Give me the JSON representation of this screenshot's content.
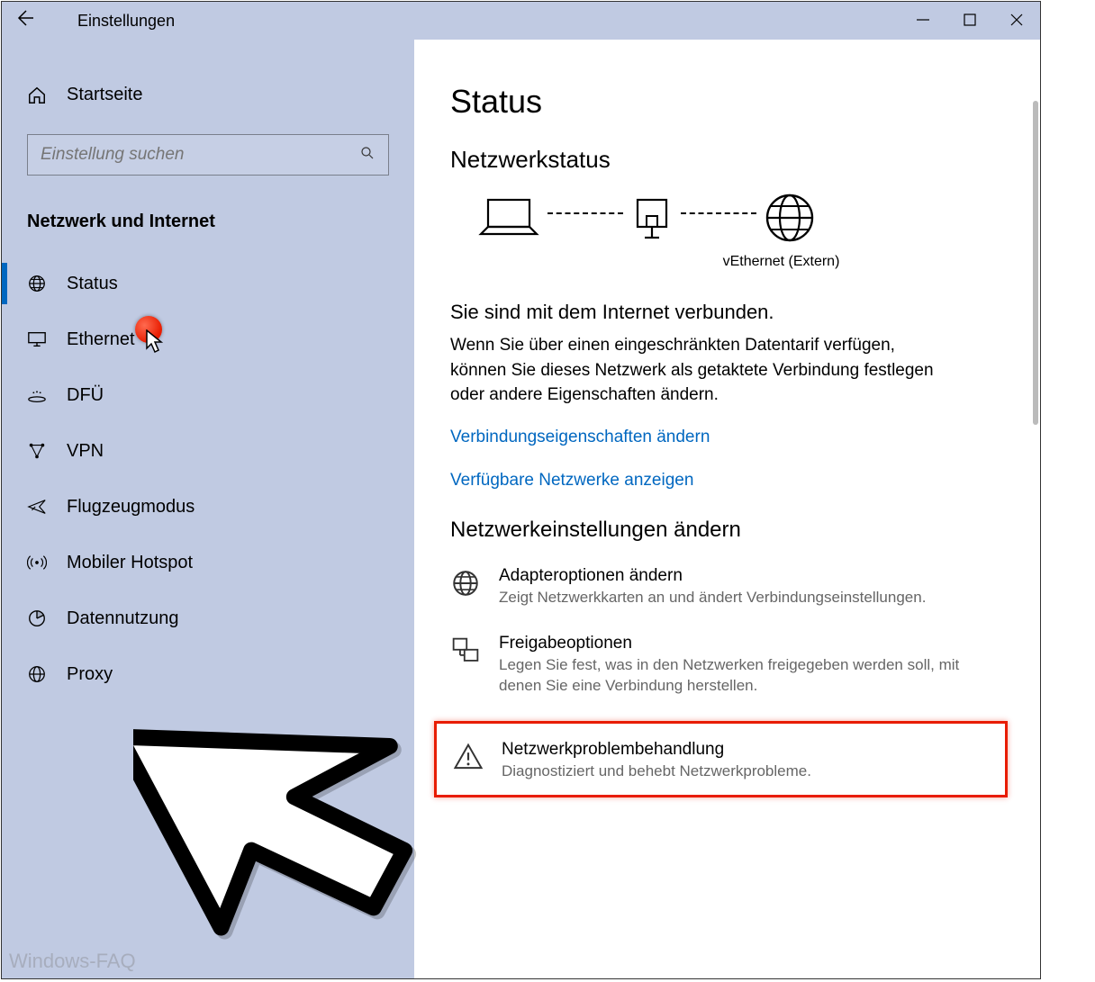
{
  "window": {
    "title": "Einstellungen"
  },
  "sidebar": {
    "home": "Startseite",
    "search_placeholder": "Einstellung suchen",
    "section": "Netzwerk und Internet",
    "items": [
      {
        "id": "status",
        "label": "Status",
        "icon": "globe-grid-icon",
        "active": true
      },
      {
        "id": "ethernet",
        "label": "Ethernet",
        "icon": "monitor-icon"
      },
      {
        "id": "dfu",
        "label": "DFÜ",
        "icon": "dialup-icon"
      },
      {
        "id": "vpn",
        "label": "VPN",
        "icon": "vpn-icon"
      },
      {
        "id": "airplane",
        "label": "Flugzeugmodus",
        "icon": "airplane-icon"
      },
      {
        "id": "hotspot",
        "label": "Mobiler Hotspot",
        "icon": "hotspot-icon"
      },
      {
        "id": "data",
        "label": "Datennutzung",
        "icon": "data-usage-icon"
      },
      {
        "id": "proxy",
        "label": "Proxy",
        "icon": "globe-icon"
      }
    ]
  },
  "main": {
    "page_title": "Status",
    "section1_title": "Netzwerkstatus",
    "diagram_label": "vEthernet (Extern)",
    "connected_title": "Sie sind mit dem Internet verbunden.",
    "connected_body": "Wenn Sie über einen eingeschränkten Datentarif verfügen, können Sie dieses Netzwerk als getaktete Verbindung festlegen oder andere Eigenschaften ändern.",
    "link1": "Verbindungseigenschaften ändern",
    "link2": "Verfügbare Netzwerke anzeigen",
    "section2_title": "Netzwerkeinstellungen ändern",
    "rows": [
      {
        "title": "Adapteroptionen ändern",
        "desc": "Zeigt Netzwerkkarten an und ändert Verbindungseinstellungen."
      },
      {
        "title": "Freigabeoptionen",
        "desc": "Legen Sie fest, was in den Netzwerken freigegeben werden soll, mit denen Sie eine Verbindung herstellen."
      },
      {
        "title": "Netzwerkproblembehandlung",
        "desc": "Diagnostiziert und behebt Netzwerkprobleme."
      }
    ]
  },
  "watermark": "Windows-FAQ",
  "annotations": {
    "highlight_marker": "red-dot",
    "callout_arrow_target": "Netzwerkproblembehandlung"
  }
}
